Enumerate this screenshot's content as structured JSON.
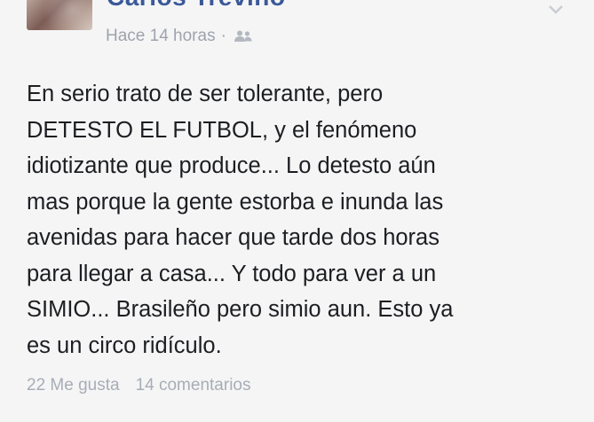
{
  "post": {
    "author": "Carlos Treviño",
    "timestamp": "Hace 14 horas",
    "separator": "·",
    "audience_icon": "friends-icon",
    "menu_icon": "chevron-down-icon",
    "text_lines": [
      "En serio trato de ser tolerante, pero",
      "DETESTO EL FUTBOL, y el fenómeno",
      "idiotizante que produce... Lo detesto aún",
      "mas porque la gente estorba e inunda las",
      "avenidas para hacer que tarde dos horas",
      "para llegar a casa... Y todo para ver a un",
      "SIMIO... Brasileño pero simio aun. Esto ya",
      "es un circo ridículo."
    ],
    "likes": "22 Me gusta",
    "comments": "14 comentarios"
  },
  "colors": {
    "author": "#3b5998",
    "meta": "#9da3ad",
    "text": "#1c1e21",
    "background": "#f5f5f6"
  }
}
